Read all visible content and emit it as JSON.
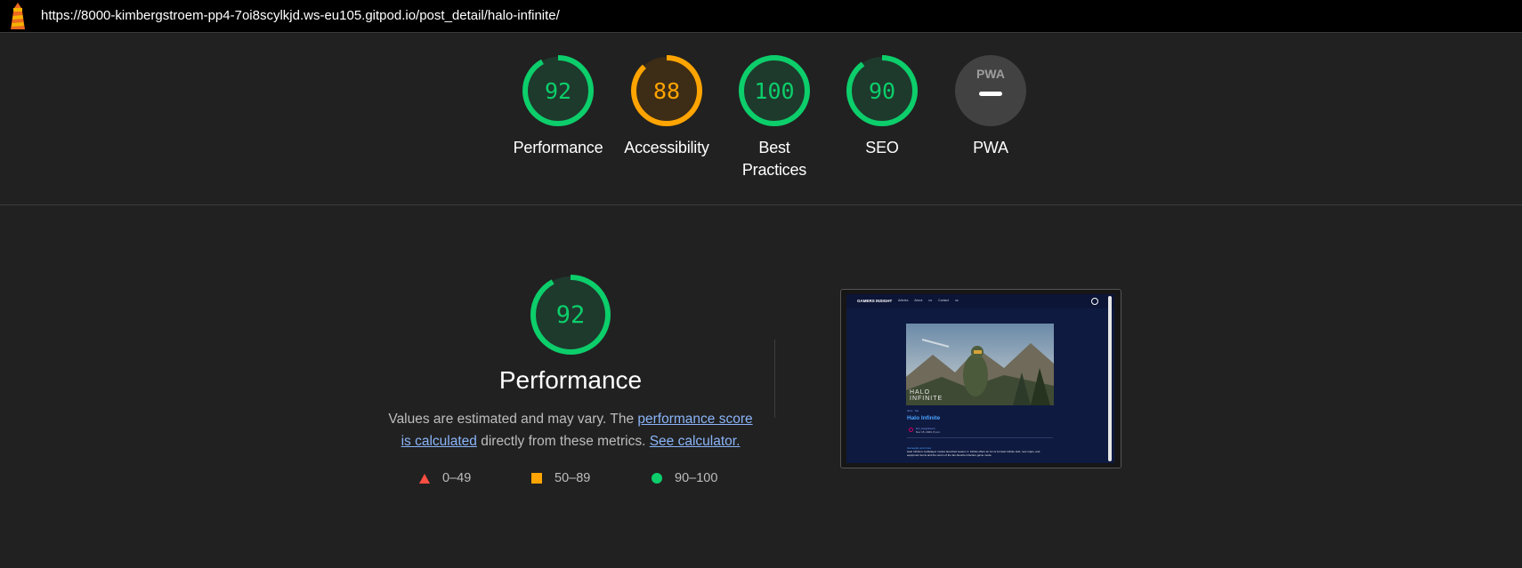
{
  "browser": {
    "url": "https://8000-kimbergstroem-pp4-7oi8scylkjd.ws-eu105.gitpod.io/post_detail/halo-infinite/"
  },
  "colors": {
    "pass": "#0cce6b",
    "average": "#ffa400",
    "fail": "#ff4e42",
    "na": "#424242"
  },
  "gauges": [
    {
      "id": "performance",
      "label": "Performance",
      "score": "92",
      "fraction": 0.92,
      "rating": "pass"
    },
    {
      "id": "accessibility",
      "label": "Accessibility",
      "score": "88",
      "fraction": 0.88,
      "rating": "average"
    },
    {
      "id": "best-practices",
      "label": "Best Practices",
      "score": "100",
      "fraction": 1.0,
      "rating": "pass"
    },
    {
      "id": "seo",
      "label": "SEO",
      "score": "90",
      "fraction": 0.9,
      "rating": "pass"
    },
    {
      "id": "pwa",
      "label": "PWA",
      "badge": "PWA",
      "score": "—",
      "rating": "na"
    }
  ],
  "performance_section": {
    "score": "92",
    "fraction": 0.92,
    "title": "Performance",
    "description_start": "Values are estimated and may vary. The ",
    "link_score": "performance score is calculated",
    "description_mid": " directly from these metrics. ",
    "link_calc": "See calculator.",
    "legend": [
      {
        "shape": "triangle",
        "range": "0–49"
      },
      {
        "shape": "square",
        "range": "50–89"
      },
      {
        "shape": "circle",
        "range": "90–100"
      }
    ]
  },
  "screenshot": {
    "brand": "GAMERS INSIGHT",
    "nav_links": "Articles About us Contact us",
    "hero_text_line1": "HALO",
    "hero_text_line2": "INFINITE",
    "tags": "xbox · fps",
    "post_title": "Halo Infinite",
    "author": "kim_bergstroem",
    "date": "Nov 15, 2023, 8 p.m.",
    "subheading": "Gameplay and more",
    "body": "Halo Infinite's multiplayer modes launched season 1. Infinite offers an 12 vs 12 Halo Infinite Hub, new maps, and equipment items and the return of the fan-favorite Infection game mode."
  }
}
